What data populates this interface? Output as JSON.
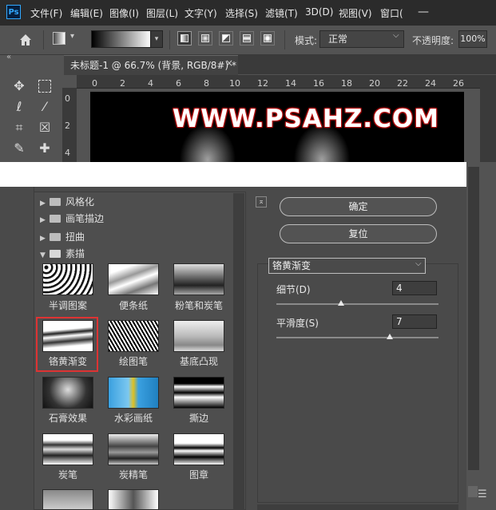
{
  "app": {
    "logo": "Ps",
    "menus": [
      "文件(F)",
      "编辑(E)",
      "图像(I)",
      "图层(L)",
      "文字(Y)",
      "选择(S)",
      "滤镜(T)",
      "3D(D)",
      "视图(V)",
      "窗口("
    ],
    "window_minimize": "—"
  },
  "options": {
    "mode_label": "模式:",
    "mode_value": "正常",
    "opacity_label": "不透明度:",
    "opacity_value": "100%",
    "gradient_types": [
      "linear",
      "radial",
      "angle",
      "reflected",
      "diamond"
    ]
  },
  "toolbar": {
    "collapse": "«",
    "tools": [
      "move-icon",
      "marquee-icon",
      "lasso-icon",
      "magic-wand-icon",
      "crop-icon",
      "frame-icon",
      "eyedropper-icon",
      "healing-icon"
    ]
  },
  "document": {
    "tab_title": "未标题-1 @ 66.7% (背景, RGB/8#) *",
    "close": "×",
    "ruler_h": [
      "0",
      "2",
      "4",
      "6",
      "8",
      "10",
      "12",
      "14",
      "16",
      "18",
      "20",
      "22",
      "24",
      "26"
    ],
    "ruler_v": [
      "0",
      "2",
      "4"
    ],
    "canvas_text": "WWW.PSAHZ.COM"
  },
  "gallery": {
    "categories": [
      {
        "label": "风格化",
        "expanded": false
      },
      {
        "label": "画笔描边",
        "expanded": false
      },
      {
        "label": "扭曲",
        "expanded": false
      },
      {
        "label": "素描",
        "expanded": true
      }
    ],
    "thumbnails": [
      "半调图案",
      "便条纸",
      "粉笔和炭笔",
      "铬黄渐变",
      "绘图笔",
      "基底凸现",
      "石膏效果",
      "水彩画纸",
      "撕边",
      "炭笔",
      "炭精笔",
      "图章"
    ],
    "selected": "铬黄渐变"
  },
  "settings": {
    "collapse": "⌅",
    "ok_label": "确定",
    "reset_label": "复位",
    "filter_name": "铬黄渐变",
    "detail_label": "细节(D)",
    "detail_value": "4",
    "detail_fraction": 0.4,
    "smoothness_label": "平滑度(S)",
    "smoothness_value": "7",
    "smoothness_fraction": 0.7
  }
}
